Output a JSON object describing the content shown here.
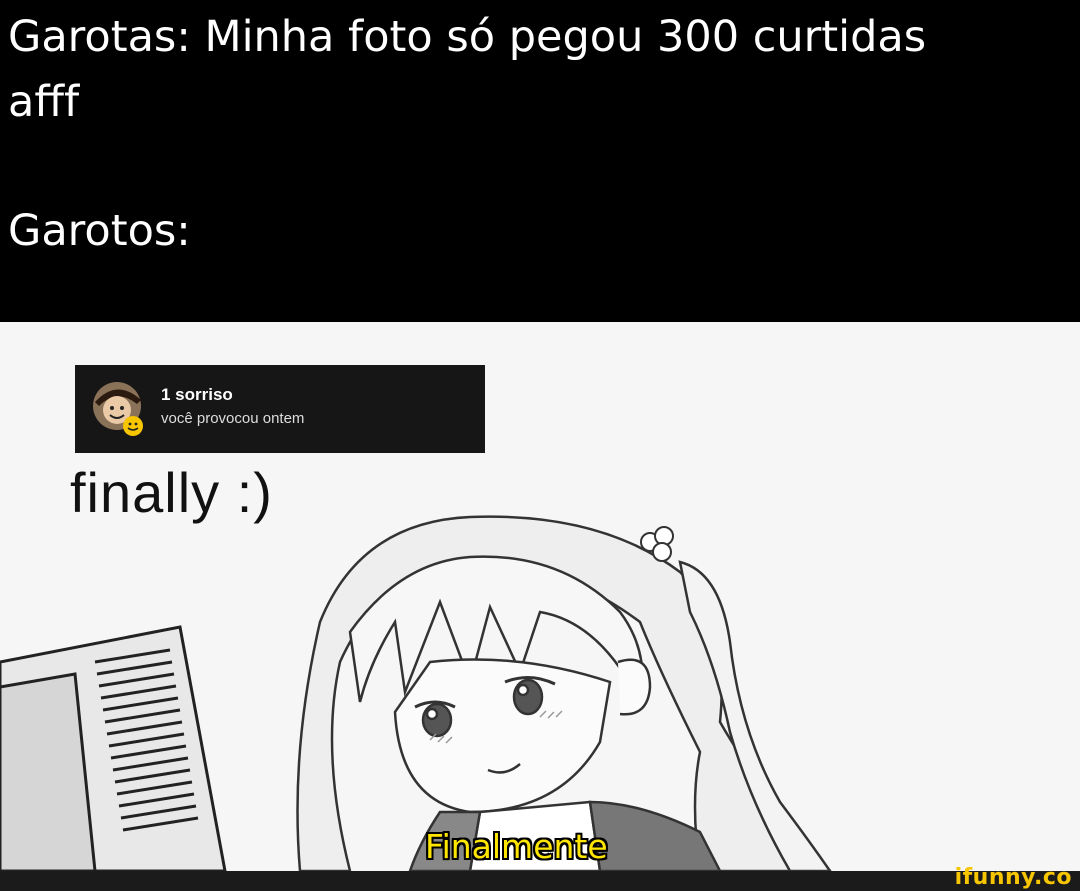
{
  "caption": {
    "line1": "Garotas: Minha foto só pegou 300 curtidas",
    "line2": "afff",
    "line3": "Garotos:"
  },
  "notification": {
    "title": "1 sorriso",
    "subtitle": "você provocou ontem",
    "avatar_icon": "smiley-avatar-icon",
    "badge_color": "#f7c600"
  },
  "meme_text": {
    "finally": "finally :)",
    "subtitle": "Finalmente"
  },
  "watermark": "ifunny.co"
}
